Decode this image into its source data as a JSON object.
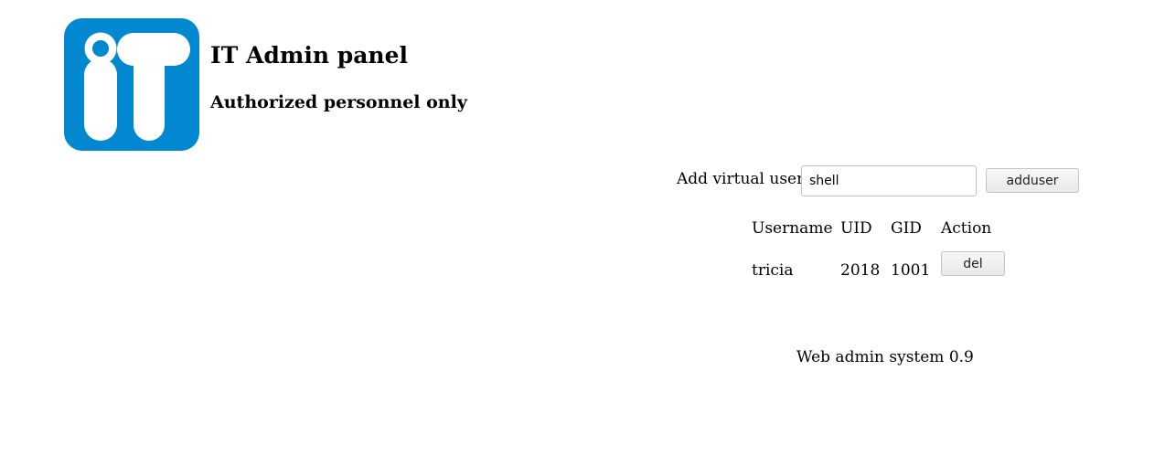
{
  "header": {
    "title": "IT Admin panel",
    "subtitle": "Authorized personnel only"
  },
  "logo": {
    "icon": "it-logo-icon",
    "text": "iT",
    "color": "#0288d1"
  },
  "add_user": {
    "label": "Add virtual user:",
    "input_value": "shell",
    "button_label": "adduser"
  },
  "users_table": {
    "columns": [
      "Username",
      "UID",
      "GID",
      "Action"
    ],
    "rows": [
      {
        "username": "tricia",
        "uid": "2018",
        "gid": "1001",
        "action_label": "del"
      }
    ]
  },
  "footer": {
    "text": "Web admin system 0.9"
  }
}
